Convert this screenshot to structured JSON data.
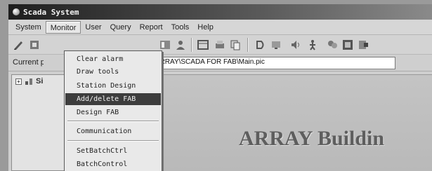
{
  "window": {
    "title": "Scada System"
  },
  "menubar": {
    "items": [
      {
        "label": "System"
      },
      {
        "label": "Monitor"
      },
      {
        "label": "User"
      },
      {
        "label": "Query"
      },
      {
        "label": "Report"
      },
      {
        "label": "Tools"
      },
      {
        "label": "Help"
      }
    ]
  },
  "toolbar": {
    "icons": [
      "edit-icon",
      "tool-icon",
      "layout-icon",
      "user-icon",
      "window-icon",
      "print-icon",
      "copy-icon",
      "display-icon",
      "sound-icon",
      "person-icon",
      "user-group-icon",
      "monitor-icon",
      "exit-icon"
    ]
  },
  "pathbar": {
    "label": "Current p",
    "value": ".ES\\ARRAY\\SCADA FOR FAB\\Main.pic"
  },
  "tree": {
    "root_label": "Si"
  },
  "content": {
    "title": "ARRAY Buildin"
  },
  "monitor_menu": {
    "items": [
      {
        "label": "Clear alarm"
      },
      {
        "label": "Draw tools"
      },
      {
        "label": "Station Design"
      },
      {
        "label": "Add/delete FAB",
        "selected": true
      },
      {
        "label": "Design FAB"
      },
      {
        "label": "Communication"
      },
      {
        "label": "SetBatchCtrl"
      },
      {
        "label": "BatchControl"
      }
    ]
  }
}
